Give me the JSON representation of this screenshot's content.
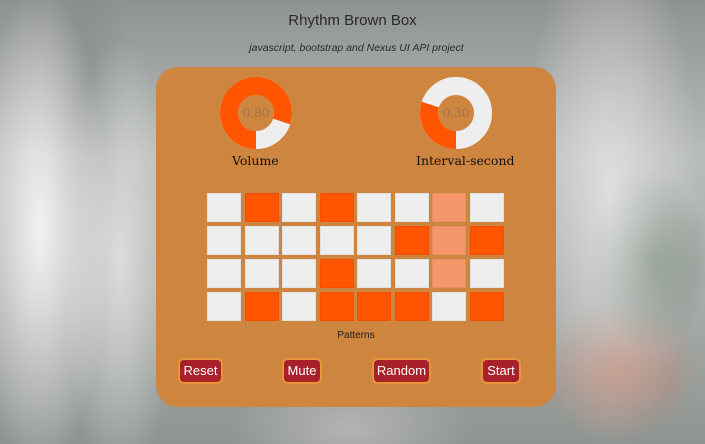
{
  "header": {
    "title": "Rhythm Brown Box",
    "subtitle": "javascript, bootstrap and Nexus UI API project"
  },
  "dials": {
    "volume": {
      "value": "0.80",
      "level": 0.8,
      "label": "Volume"
    },
    "interval": {
      "value": "0.30",
      "level": 0.3,
      "label": "Interval-second"
    }
  },
  "sequencer": {
    "label": "Patterns",
    "active_column": 6,
    "rows": [
      [
        0,
        1,
        0,
        1,
        0,
        0,
        0,
        0
      ],
      [
        0,
        0,
        0,
        0,
        0,
        1,
        0,
        1
      ],
      [
        0,
        0,
        0,
        1,
        0,
        0,
        0,
        0
      ],
      [
        0,
        1,
        0,
        1,
        1,
        1,
        0,
        1
      ]
    ]
  },
  "buttons": {
    "reset": "Reset",
    "mute": "Mute",
    "random": "Random",
    "start": "Start"
  },
  "colors": {
    "panel": "#cd853f",
    "accent": "#ff5500",
    "cell_off": "#efeeee",
    "button": "#a8202a"
  }
}
